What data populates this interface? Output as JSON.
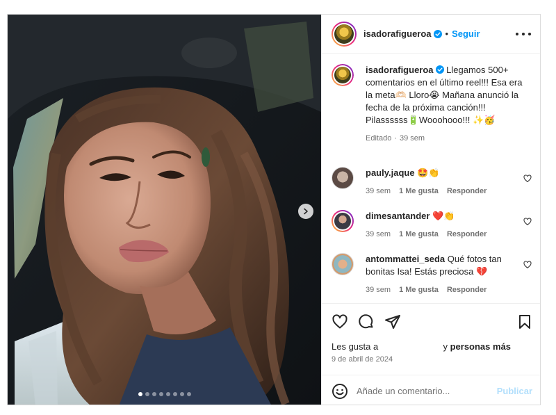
{
  "post": {
    "author": "isadorafigueroa",
    "follow_label": "Seguir",
    "separator": "•",
    "caption": {
      "username": "isadorafigueroa",
      "text": "Llegamos 500+ comentarios en el último reel!!! Esa era la meta🫶🏻 Lloro😭 Mañana anunció la fecha de la próxima canción!!! Pilassssss🔋Woooh­ooo!!! ✨🥳",
      "edited": "Editado",
      "time": "39 sem"
    },
    "comments": [
      {
        "username": "pauly.jaque",
        "text": "🤩👏",
        "time": "39 sem",
        "likes": "1 Me gusta",
        "reply": "Responder"
      },
      {
        "username": "dimesantander",
        "text": "❤️👏",
        "time": "39 sem",
        "likes": "1 Me gusta",
        "reply": "Responder"
      },
      {
        "username": "antommattei_seda",
        "text": "Qué fotos tan bonitas Isa! Estás preciosa 💔",
        "time": "39 sem",
        "likes": "1 Me gusta",
        "reply": "Responder"
      }
    ],
    "likes": {
      "prefix": "Les gusta a",
      "connector": "y",
      "suffix": "personas más"
    },
    "date": "9 de abril de 2024",
    "add_comment": {
      "placeholder": "Añade un comentario...",
      "publish_label": "Publicar"
    },
    "carousel": {
      "total_slides": 8,
      "active_slide": 1
    }
  },
  "colors": {
    "accent": "#0095f6",
    "publish_disabled": "#b2dffc",
    "muted_text": "#737373",
    "border": "#dbdbdb"
  },
  "icons": {
    "next": "chevron-right-icon",
    "like": "heart-icon",
    "comment": "comment-bubble-icon",
    "share": "paper-plane-icon",
    "save": "bookmark-icon",
    "emoji": "smiley-icon",
    "more": "more-options-icon"
  }
}
